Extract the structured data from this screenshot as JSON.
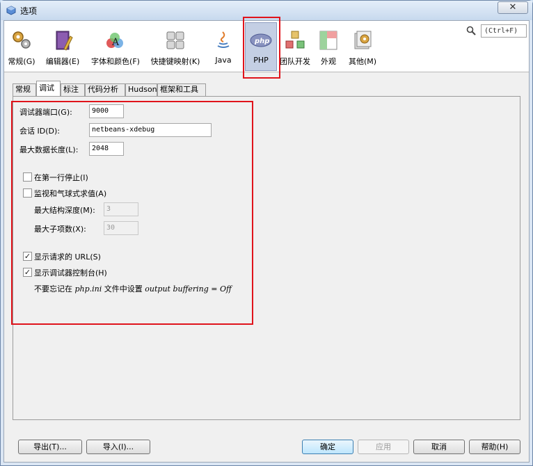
{
  "window": {
    "title": "选项",
    "close_glyph": "✕"
  },
  "toolbar": {
    "categories": [
      {
        "label": "常规(G)",
        "icon": "gears-icon"
      },
      {
        "label": "编辑器(E)",
        "icon": "editor-icon"
      },
      {
        "label": "字体和颜色(F)",
        "icon": "fonts-colors-icon"
      },
      {
        "label": "快捷键映射(K)",
        "icon": "keymap-icon"
      },
      {
        "label": "Java",
        "icon": "java-icon"
      },
      {
        "label": "PHP",
        "icon": "php-icon",
        "selected": true
      },
      {
        "label": "团队开发",
        "icon": "team-icon"
      },
      {
        "label": "外观",
        "icon": "appearance-icon"
      },
      {
        "label": "其他(M)",
        "icon": "misc-icon"
      }
    ],
    "search_placeholder": "(Ctrl+F)"
  },
  "tabs": [
    "常规",
    "调试",
    "标注",
    "代码分析",
    "Hudson",
    "框架和工具"
  ],
  "active_tab": "调试",
  "debug": {
    "port_label": "调试器端口(G):",
    "port_value": "9000",
    "session_label": "会话 ID(D):",
    "session_value": "netbeans-xdebug",
    "maxlen_label": "最大数据长度(L):",
    "maxlen_value": "2048",
    "stop_first_line_label": "在第一行停止(I)",
    "stop_first_line_checked": false,
    "watch_label": "监视和气球式求值(A)",
    "watch_checked": false,
    "depth_label": "最大结构深度(M):",
    "depth_value": "3",
    "children_label": "最大子项数(X):",
    "children_value": "30",
    "show_url_label": "显示请求的 URL(S)",
    "show_url_checked": true,
    "show_console_label": "显示调试器控制台(H)",
    "show_console_checked": true,
    "note_prefix": "不要忘记在 ",
    "note_file": "php.ini",
    "note_middle": " 文件中设置 ",
    "note_setting": "output buffering = Off"
  },
  "buttons": {
    "export": "导出(T)...",
    "import": "导入(I)...",
    "ok": "确定",
    "apply": "应用",
    "cancel": "取消",
    "help": "帮助(H)"
  },
  "colors": {
    "highlight": "#e0131b",
    "selected_bg": "#c4cfe4"
  }
}
